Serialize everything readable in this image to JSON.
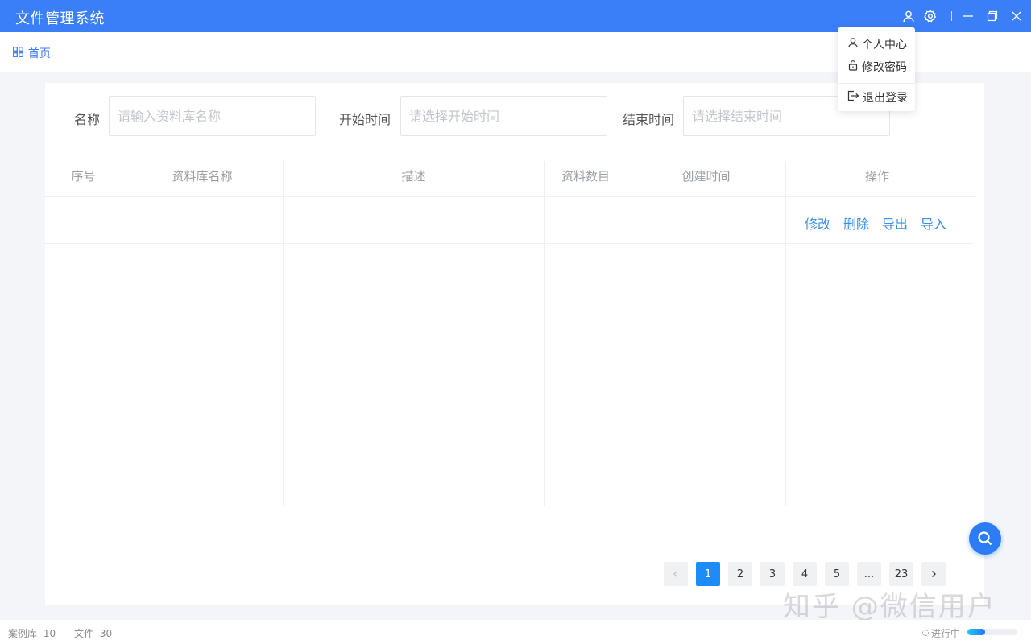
{
  "app": {
    "title": "文件管理系统",
    "title_bar_color": "#3a7ef8"
  },
  "titlebar": {
    "icons": [
      "user-icon",
      "gear-icon",
      "minimize-icon",
      "maximize-icon",
      "close-icon"
    ]
  },
  "nav": {
    "home_label": "首页",
    "home_icon": "grid-icon"
  },
  "filters": {
    "name_label": "名称",
    "name_placeholder": "请输入资料库名称",
    "start_label": "开始时间",
    "start_placeholder": "请选择开始时间",
    "end_label": "结束时间",
    "end_placeholder": "请选择结束时间"
  },
  "table": {
    "columns": [
      "序号",
      "资料库名称",
      "描述",
      "资料数目",
      "创建时间",
      "操作"
    ],
    "rows": [
      {
        "index": "",
        "name": "",
        "description": "",
        "count": "",
        "created": "",
        "actions": [
          "修改",
          "删除",
          "导出",
          "导入"
        ]
      }
    ]
  },
  "pagination": {
    "prev_icon": "chevron-left-icon",
    "pages": [
      "1",
      "2",
      "3",
      "4",
      "5",
      "...",
      "23"
    ],
    "current": "1",
    "next_icon": "chevron-right-icon"
  },
  "fab": {
    "icon": "search-icon",
    "color": "#2c7cf6"
  },
  "watermark": "知乎 @微信用户",
  "status": {
    "library_label": "案例库",
    "library_count": "10",
    "files_label": "文件",
    "files_count": "30",
    "progress_label": "进行中",
    "progress_fraction": 0.35
  },
  "user_menu": {
    "items": [
      {
        "icon": "user-icon",
        "label": "个人中心"
      },
      {
        "icon": "lock-icon",
        "label": "修改密码"
      },
      {
        "icon": "logout-icon",
        "label": "退出登录"
      }
    ]
  },
  "accent_color": "#1d8cf8"
}
